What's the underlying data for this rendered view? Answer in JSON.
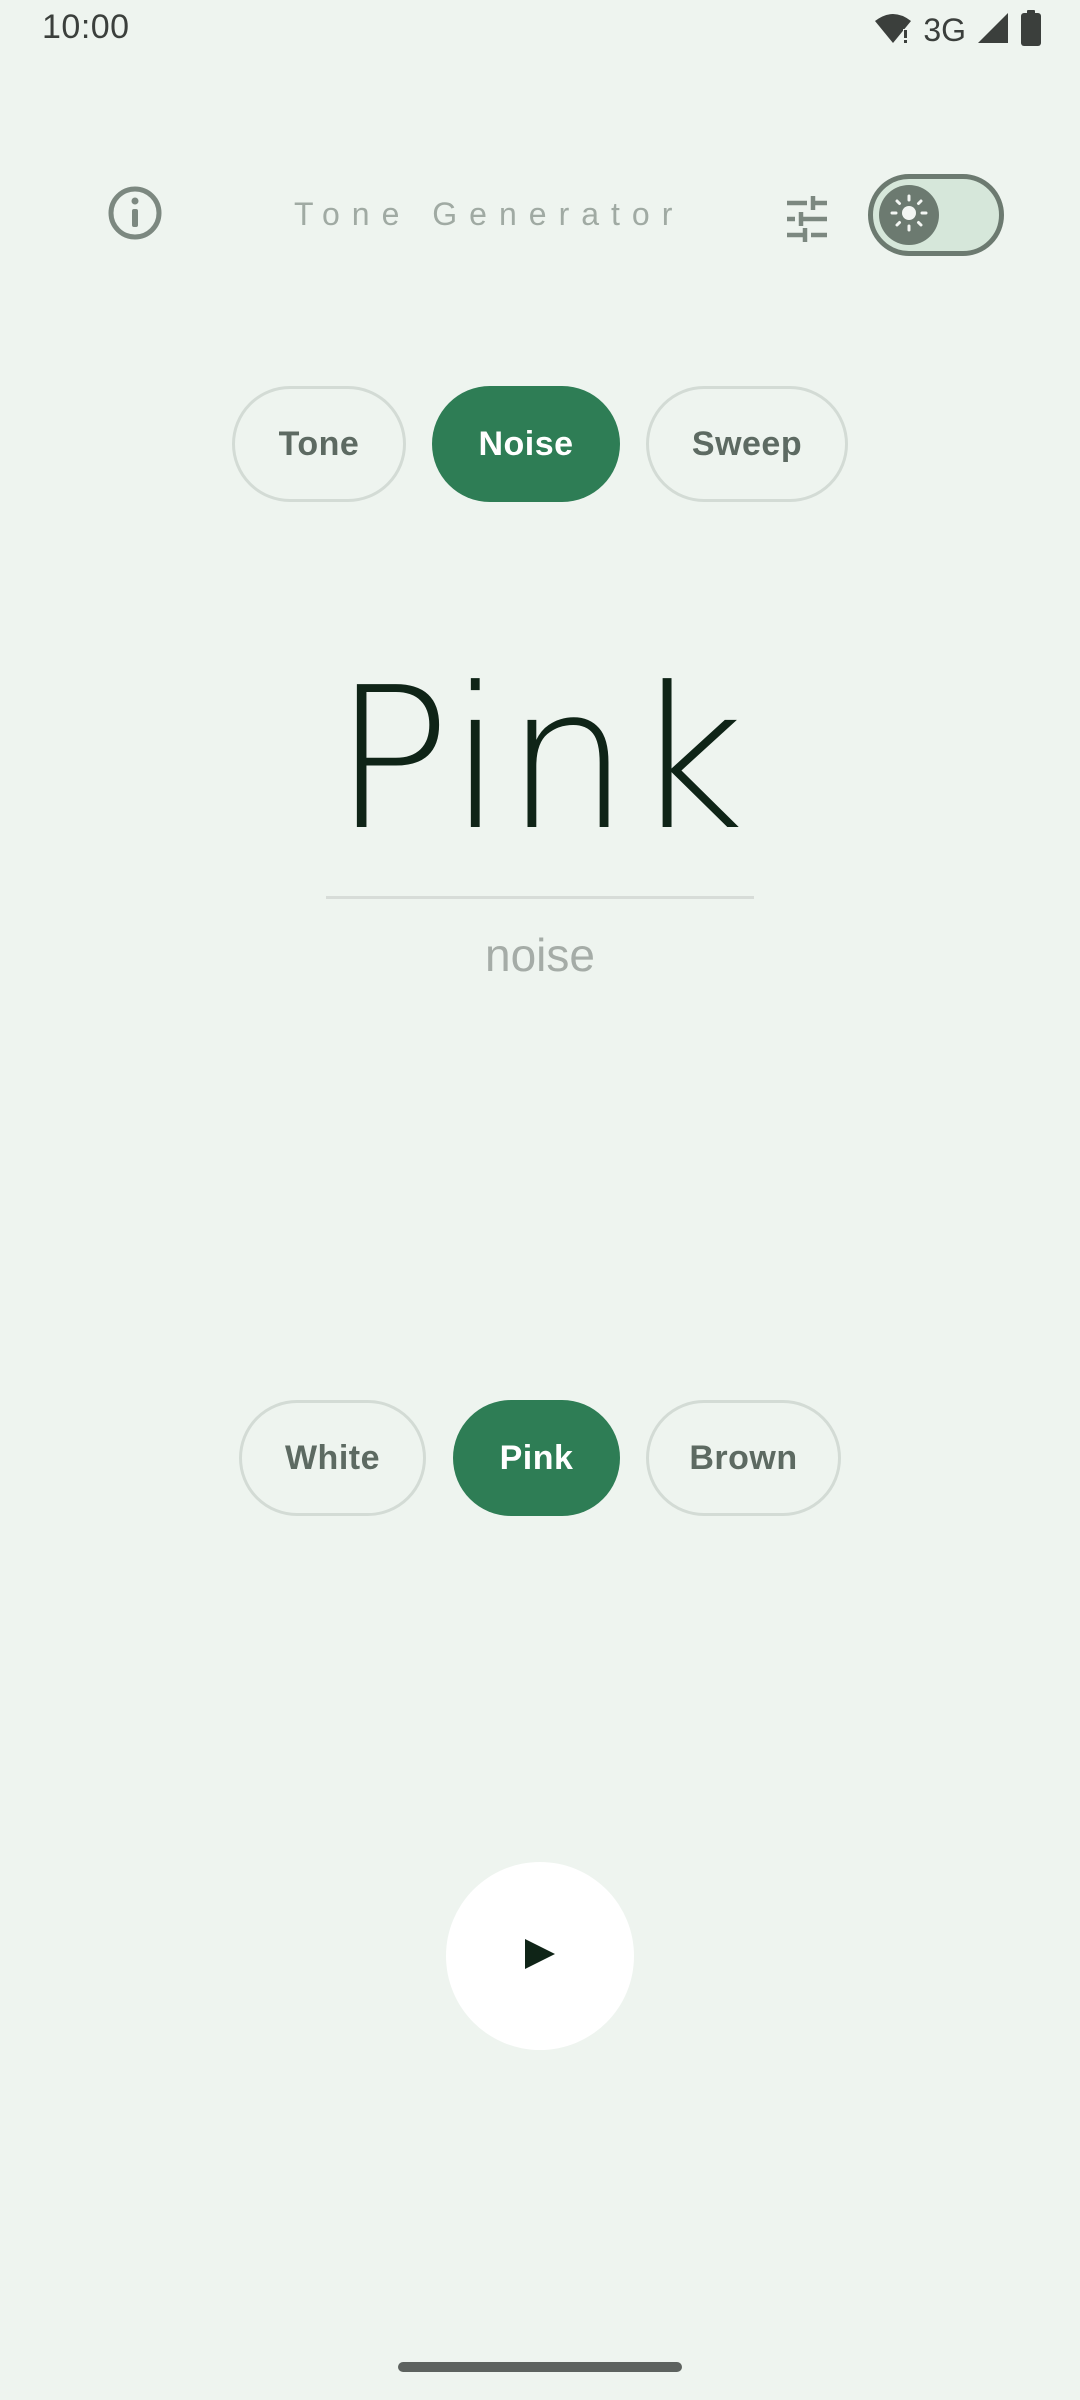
{
  "status_bar": {
    "time": "10:00",
    "network": "3G"
  },
  "app_bar": {
    "title": "Tone Generator",
    "info_icon": "info-icon",
    "tune_icon": "tune-icon",
    "theme_icon": "sun-icon",
    "theme_toggle_on": false
  },
  "mode_tabs": [
    {
      "label": "Tone",
      "selected": false
    },
    {
      "label": "Noise",
      "selected": true
    },
    {
      "label": "Sweep",
      "selected": false
    }
  ],
  "display": {
    "main": "Pink",
    "sub": "noise"
  },
  "noise_types": [
    {
      "label": "White",
      "selected": false
    },
    {
      "label": "Pink",
      "selected": true
    },
    {
      "label": "Brown",
      "selected": false
    }
  ],
  "play_button": {
    "icon": "play-icon",
    "glyph": "▶"
  },
  "colors": {
    "background": "#eef4ef",
    "accent": "#2e7d55",
    "chip_border": "#d3dbd5"
  }
}
